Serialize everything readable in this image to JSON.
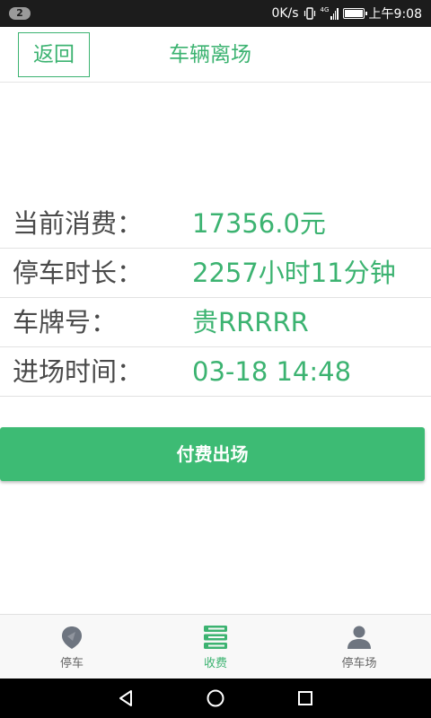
{
  "status_bar": {
    "notification_count": "2",
    "net_speed": "0K/s",
    "signal_label": "4G",
    "time": "上午9:08"
  },
  "header": {
    "back_label": "返回",
    "title": "车辆离场"
  },
  "info": [
    {
      "label": "当前消费：",
      "value": "17356.0元"
    },
    {
      "label": "停车时长：",
      "value": "2257小时11分钟"
    },
    {
      "label": "车牌号：",
      "value": "贵RRRRR"
    },
    {
      "label": "进场时间：",
      "value": "03-18 14:48"
    }
  ],
  "pay_button_label": "付费出场",
  "tabs": [
    {
      "label": "停车",
      "icon": "map-pin-icon",
      "active": false
    },
    {
      "label": "收费",
      "icon": "payment-list-icon",
      "active": true
    },
    {
      "label": "停车场",
      "icon": "user-icon",
      "active": false
    }
  ],
  "colors": {
    "accent": "#3cb371",
    "button": "#3dbb74",
    "label_text": "#4a4a4a"
  }
}
